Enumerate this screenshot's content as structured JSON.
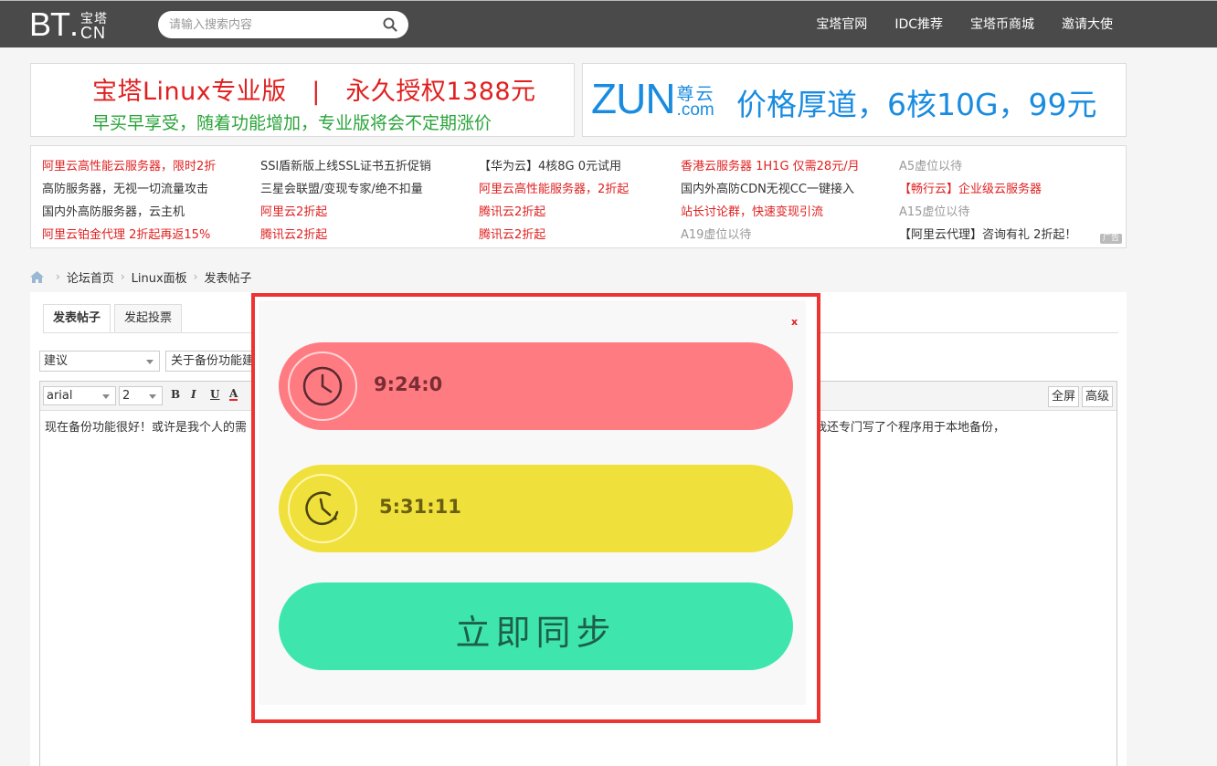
{
  "header": {
    "logo_main": "BT",
    "logo_dot": ".",
    "logo_zh": "宝塔",
    "logo_cn": "CN",
    "search_placeholder": "请输入搜索内容",
    "nav": [
      "宝塔官网",
      "IDC推荐",
      "宝塔币商城",
      "邀请大使"
    ]
  },
  "banners": {
    "left": {
      "line1": "宝塔Linux专业版　|　永久授权1388元",
      "line2": "早买早享受，随着功能增加，专业版将会不定期涨价"
    },
    "right": {
      "logo_word": "ZUN",
      "logo_zh": "尊云",
      "logo_com": ".com",
      "text": "价格厚道，6核10G，99元"
    }
  },
  "ads": {
    "col1": [
      "阿里云高性能云服务器，限时2折",
      "高防服务器，无视一切流量攻击",
      "国内外高防服务器，云主机",
      "阿里云铂金代理 2折起再返15%"
    ],
    "col2": [
      "SSl盾新版上线SSL证书五折促销",
      "三星会联盟/变现专家/绝不扣量",
      "阿里云2折起",
      "腾讯云2折起"
    ],
    "col3": [
      "【华为云】4核8G 0元试用",
      "阿里云高性能服务器，2折起",
      "腾讯云2折起",
      "腾讯云2折起"
    ],
    "col4": [
      "香港云服务器 1H1G 仅需28元/月",
      "国内外高防CDN无视CC一键接入",
      "站长讨论群，快速变现引流",
      "A19虚位以待"
    ],
    "col5": [
      "A5虚位以待",
      "【畅行云】企业级云服务器",
      "A15虚位以待",
      "【阿里云代理】咨询有礼 2折起！"
    ],
    "tag": "广告"
  },
  "breadcrumb": {
    "items": [
      "论坛首页",
      "Linux面板",
      "发表帖子"
    ],
    "sep": "›"
  },
  "editor": {
    "tabs": [
      "发表帖子",
      "发起投票"
    ],
    "type_value": "建议",
    "subject_value": "关于备份功能建议",
    "font_value": "arial",
    "size_value": "2",
    "btn_bold": "B",
    "btn_italic": "I",
    "btn_underline": "U",
    "btn_color": "A",
    "btn_fullscreen": "全屏",
    "btn_advanced": "高级",
    "body_start": "现在备份功能很好！或许是我个人的需",
    "body_end": "此我还专门写了个程序用于本地备份，"
  },
  "modal": {
    "close_label": "x",
    "time_1": "9:24:0",
    "time_2": "5:31:11",
    "sync_label": "立即同步",
    "colors": {
      "pill_1": "#ff7b82",
      "pill_2": "#f0e03c",
      "pill_3": "#3ee6ae",
      "border": "#ee3333"
    }
  }
}
